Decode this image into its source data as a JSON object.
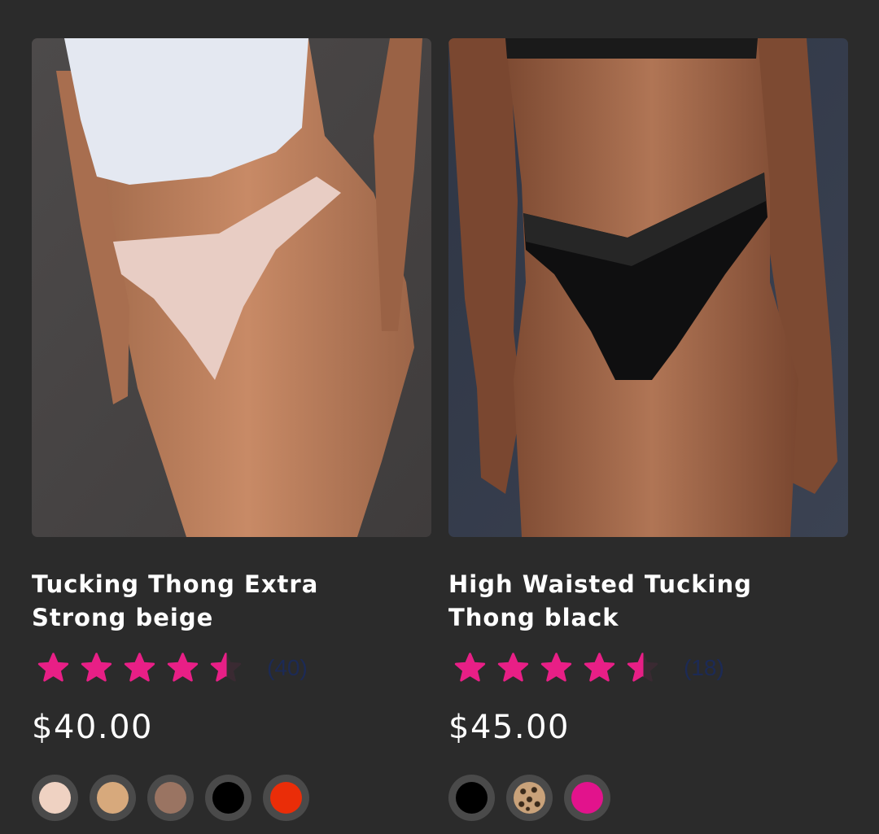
{
  "products": [
    {
      "title": "Tucking Thong Extra Strong beige",
      "photo_alt": "Tucking Thong Extra Strong beige",
      "rating": 4.5,
      "reviews": "(40)",
      "price": "$40.00",
      "swatches": [
        {
          "name": "beige",
          "color": "#efd2c2"
        },
        {
          "name": "tan",
          "color": "#d7a97c"
        },
        {
          "name": "brown",
          "color": "#9a7462"
        },
        {
          "name": "black",
          "color": "#000000"
        },
        {
          "name": "red",
          "color": "#ea2d08"
        }
      ]
    },
    {
      "title": "High Waisted Tucking Thong black",
      "photo_alt": "High Waisted Tucking Thong black",
      "rating": 4.5,
      "reviews": "(18)",
      "price": "$45.00",
      "swatches": [
        {
          "name": "black",
          "color": "#000000"
        },
        {
          "name": "leopard",
          "color": "pattern"
        },
        {
          "name": "pink",
          "color": "#e2138c"
        }
      ]
    }
  ],
  "colors": {
    "background": "#2b2b2b",
    "star": "#e81f86",
    "review_count": "#1c2a55"
  }
}
